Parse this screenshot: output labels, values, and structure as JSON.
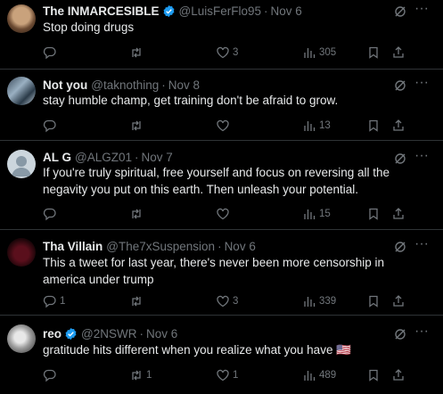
{
  "tweets": [
    {
      "name": "The INMARCESIBLE",
      "verified": true,
      "handle": "@LuisFerFlo95",
      "time": "Nov 6",
      "text": "Stop doing drugs",
      "replies": "",
      "retweets": "",
      "likes": "3",
      "views": "305"
    },
    {
      "name": "Not you",
      "verified": false,
      "handle": "@taknothing",
      "time": "Nov 8",
      "text": "stay humble champ, get training don't be afraid to grow.",
      "replies": "",
      "retweets": "",
      "likes": "",
      "views": "13"
    },
    {
      "name": "AL G",
      "verified": false,
      "handle": "@ALGZ01",
      "time": "Nov 7",
      "text": "If you're truly spiritual, free yourself and focus on reversing all the negavity you put on this earth. Then unleash your potential.",
      "replies": "",
      "retweets": "",
      "likes": "",
      "views": "15"
    },
    {
      "name": "Tha Villain",
      "verified": false,
      "handle": "@The7xSuspension",
      "time": "Nov 6",
      "text": "This a tweet for last year, there's never been more censorship in america under trump",
      "replies": "1",
      "retweets": "",
      "likes": "3",
      "views": "339"
    },
    {
      "name": "reo",
      "verified": true,
      "handle": "@2NSWR",
      "time": "Nov 6",
      "text": "gratitude hits different when you realize what you have 🇺🇸",
      "replies": "",
      "retweets": "1",
      "likes": "1",
      "views": "489"
    }
  ],
  "colors": {
    "background": "#000000",
    "text": "#e7e9ea",
    "muted": "#71767b",
    "verified": "#1d9bf0",
    "divider": "#2f3336"
  },
  "icons": {
    "reply": "reply-icon",
    "retweet": "retweet-icon",
    "like": "heart-icon",
    "views": "views-icon",
    "grok": "grok-icon",
    "more": "more-icon"
  }
}
